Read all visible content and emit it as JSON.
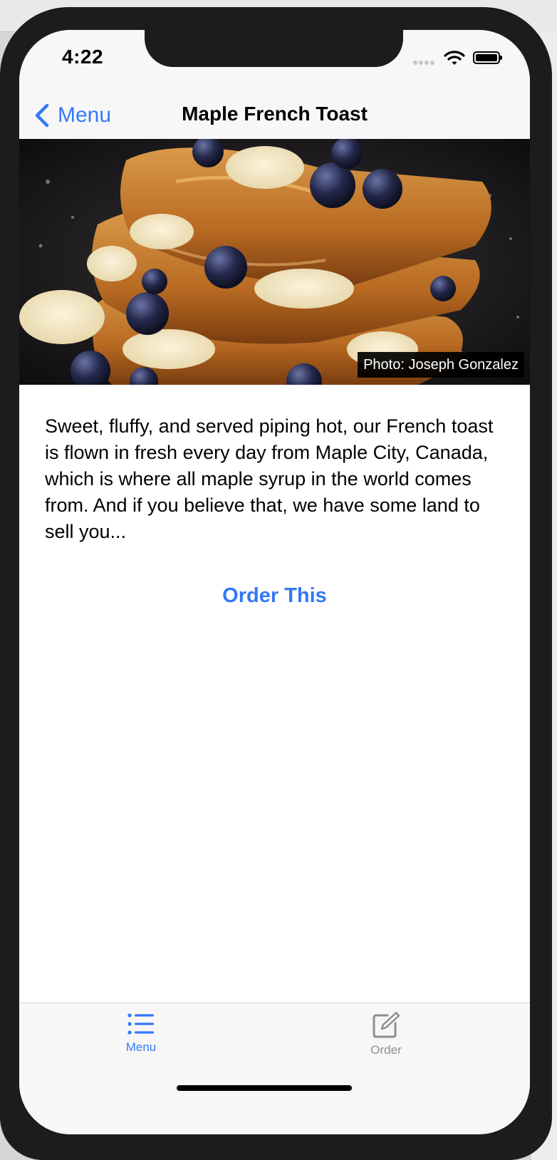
{
  "status_bar": {
    "time": "4:22",
    "icons": [
      "cellular-signal-icon",
      "wifi-icon",
      "battery-icon"
    ]
  },
  "nav": {
    "back_label": "Menu",
    "title": "Maple French Toast"
  },
  "hero": {
    "image": "maple-french-toast-photo",
    "credit": "Photo: Joseph Gonzalez"
  },
  "description": "Sweet, fluffy, and served piping hot, our French toast is flown in fresh every day from Maple City, Canada, which is where all maple syrup in the world comes from. And if you believe that, we have some land to sell you...",
  "order_button": "Order This",
  "tab_bar": {
    "tabs": [
      {
        "label": "Menu",
        "icon": "list-icon",
        "selected": true
      },
      {
        "label": "Order",
        "icon": "compose-icon",
        "selected": false
      }
    ]
  },
  "colors": {
    "accent": "#3478f6",
    "inactive_tab": "#8e8e93",
    "bar_background": "#f7f7f7"
  }
}
